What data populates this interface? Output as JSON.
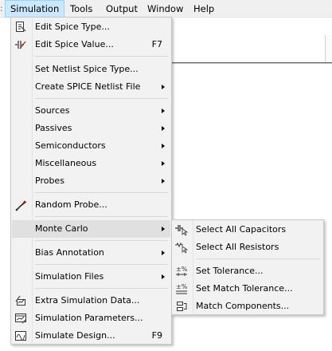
{
  "menubar": {
    "items": [
      {
        "label": "Simulation"
      },
      {
        "label": "Tools"
      },
      {
        "label": "Output"
      },
      {
        "label": "Window"
      },
      {
        "label": "Help"
      }
    ]
  },
  "simulation_menu": {
    "items": [
      {
        "label": "Edit Spice Type...",
        "shortcut": "",
        "icon": "spice-type-icon"
      },
      {
        "label": "Edit Spice Value...",
        "shortcut": "F7",
        "icon": "spice-value-icon"
      },
      {
        "label": "Set Netlist Spice Type...",
        "shortcut": ""
      },
      {
        "label": "Create SPICE Netlist File",
        "submenu": true
      },
      {
        "label": "Sources",
        "submenu": true
      },
      {
        "label": "Passives",
        "submenu": true
      },
      {
        "label": "Semiconductors",
        "submenu": true
      },
      {
        "label": "Miscellaneous",
        "submenu": true
      },
      {
        "label": "Probes",
        "submenu": true
      },
      {
        "label": "Random Probe...",
        "icon": "probe-icon"
      },
      {
        "label": "Monte Carlo",
        "submenu": true
      },
      {
        "label": "Bias Annotation",
        "submenu": true
      },
      {
        "label": "Simulation Files",
        "submenu": true
      },
      {
        "label": "Extra Simulation Data...",
        "icon": "extra-data-icon"
      },
      {
        "label": "Simulation Parameters...",
        "icon": "parameters-icon"
      },
      {
        "label": "Simulate Design...",
        "shortcut": "F9",
        "icon": "simulate-icon"
      }
    ]
  },
  "monte_carlo_submenu": {
    "items": [
      {
        "label": "Select All Capacitors",
        "icon": "capacitor-select-icon"
      },
      {
        "label": "Select All Resistors",
        "icon": "resistor-select-icon"
      },
      {
        "label": "Set Tolerance...",
        "icon": "tolerance-icon"
      },
      {
        "label": "Set Match Tolerance...",
        "icon": "match-tolerance-icon"
      },
      {
        "label": "Match Components...",
        "icon": "match-components-icon"
      }
    ]
  },
  "colors": {
    "highlight": "#e0e0e0",
    "menubar_active": "#cce8ff",
    "menu_bg": "#f2f2f2"
  }
}
